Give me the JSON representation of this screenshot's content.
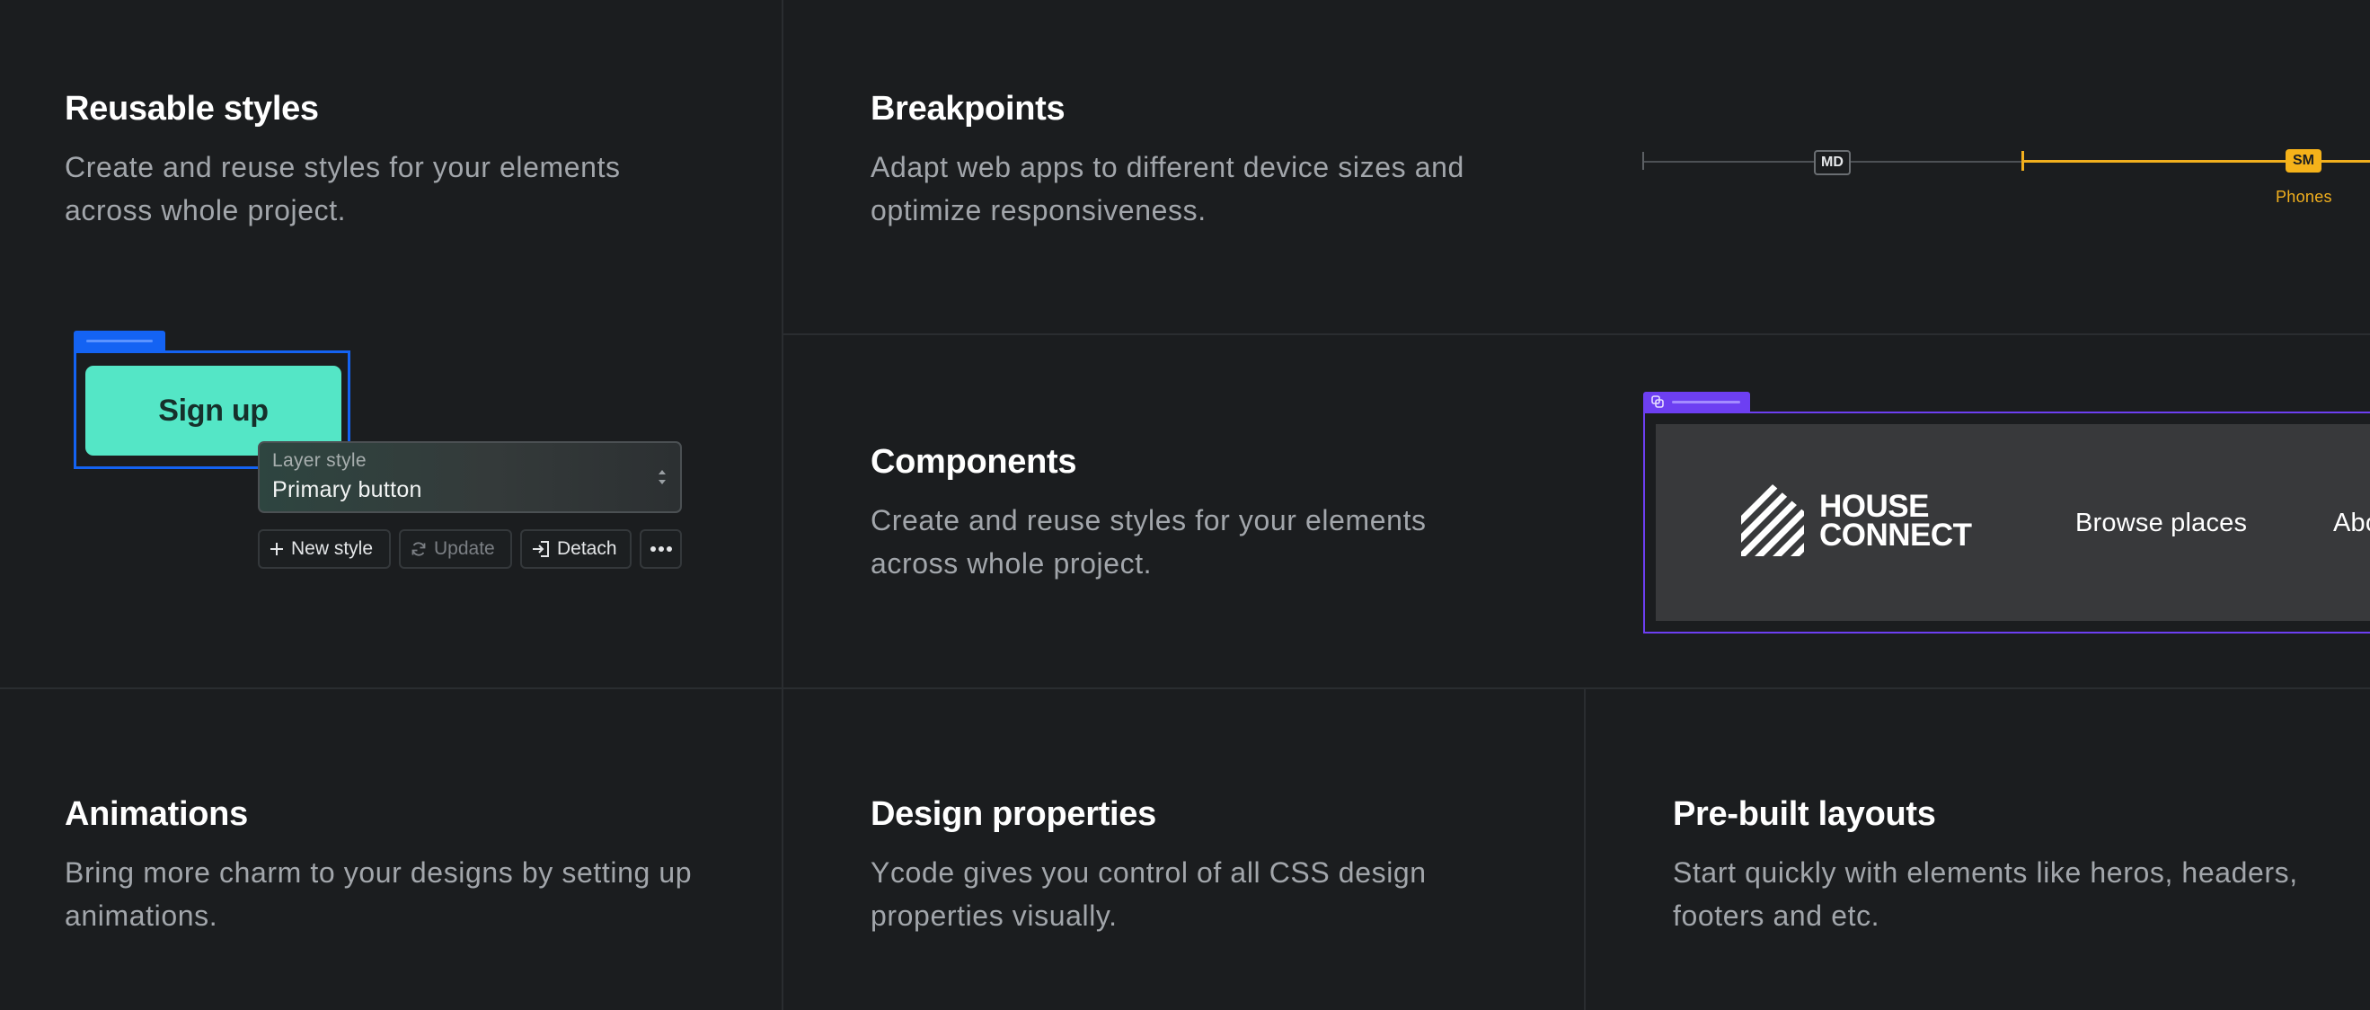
{
  "features": {
    "reusable_styles": {
      "title": "Reusable styles",
      "description": "Create and reuse styles for your elements across whole project.",
      "demo": {
        "button_label": "Sign up",
        "layer_style_label": "Layer style",
        "layer_style_value": "Primary button",
        "actions": [
          "New style",
          "Update",
          "Detach"
        ]
      }
    },
    "breakpoints": {
      "title": "Breakpoints",
      "description": "Adapt web apps to different device sizes and optimize responsiveness.",
      "demo": {
        "md_label": "MD",
        "sm_label": "SM",
        "sm_caption": "Phones",
        "active_color": "#f2b01e"
      }
    },
    "components": {
      "title": "Components",
      "description": "Create and reuse styles for your elements across whole project.",
      "demo": {
        "logo_line1": "HOUSE",
        "logo_line2": "CONNECT",
        "nav_links": [
          "Browse places",
          "Abo"
        ]
      }
    },
    "animations": {
      "title": "Animations",
      "description": "Bring more charm to your designs by setting up animations."
    },
    "design_properties": {
      "title": "Design properties",
      "description": "Ycode gives you control of all CSS design properties visually."
    },
    "prebuilt_layouts": {
      "title": "Pre-built layouts",
      "description": "Start quickly with elements like heros, headers, footers and etc."
    }
  },
  "colors": {
    "background": "#1b1d1f",
    "selection_blue": "#1463f3",
    "signup_green": "#54e6c6",
    "component_purple": "#6d3ff2"
  }
}
